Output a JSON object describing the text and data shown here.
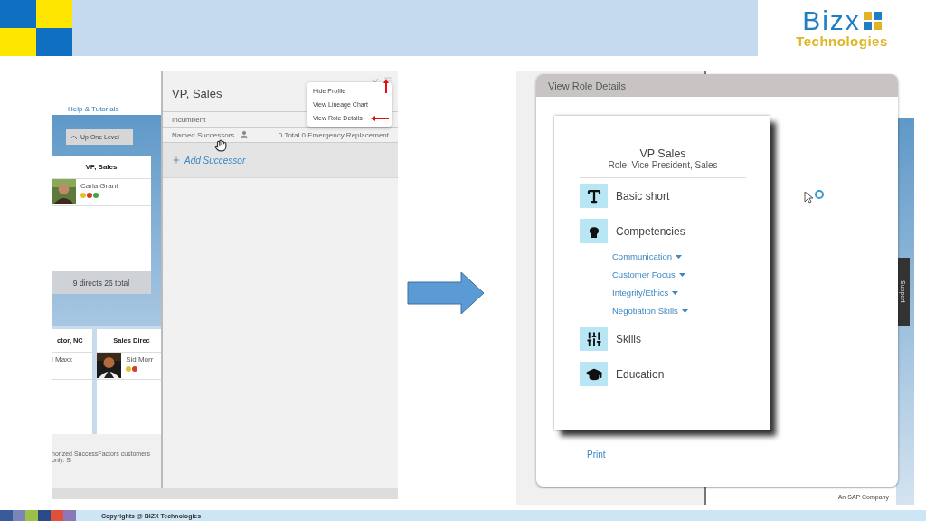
{
  "header": {
    "logo": {
      "name": "Bizx",
      "tagline": "Technologies"
    }
  },
  "left_screen": {
    "help_link": "Help & Tutorials",
    "up_button": "Up One Level",
    "top_card": {
      "title": "VP, Sales",
      "person": "Carla Grant"
    },
    "directs": "9 directs 26 total",
    "lower_cards": [
      {
        "title": "ctor, NC",
        "person": "l Maxx",
        "photo": false
      },
      {
        "title": "Sales Direc",
        "person": "Sid Morr",
        "photo": true
      }
    ],
    "footer_note": "norized SuccessFactors customers only. S",
    "panel": {
      "title": "VP, Sales",
      "menu": [
        {
          "label": "Hide Profile",
          "kind": "uparrow"
        },
        {
          "label": "View Lineage Chart",
          "kind": "plain"
        },
        {
          "label": "View Role Details",
          "kind": "leftarrow"
        }
      ],
      "incumbent": "Incumbent",
      "successors_label": "Named Successors",
      "successors_count": "0 Total 0 Emergency Replacement",
      "add": "Add Successor"
    }
  },
  "right_screen": {
    "side_tab": "Support",
    "logo_sub": "An SAP Company",
    "modal": {
      "title": "View Role Details",
      "role_title": "VP Sales",
      "role_sub": "Role: Vice President, Sales",
      "sections": [
        {
          "label": "Basic short",
          "kind": "text"
        },
        {
          "label": "Competencies",
          "kind": "head",
          "items": [
            "Communication",
            "Customer Focus",
            "Integrity/Ethics",
            "Negotiation Skills"
          ]
        },
        {
          "label": "Skills",
          "kind": "sliders"
        },
        {
          "label": "Education",
          "kind": "cap"
        }
      ],
      "print": "Print"
    }
  },
  "footer": {
    "copyright": "Copyrights @ BIZX Technologies"
  }
}
